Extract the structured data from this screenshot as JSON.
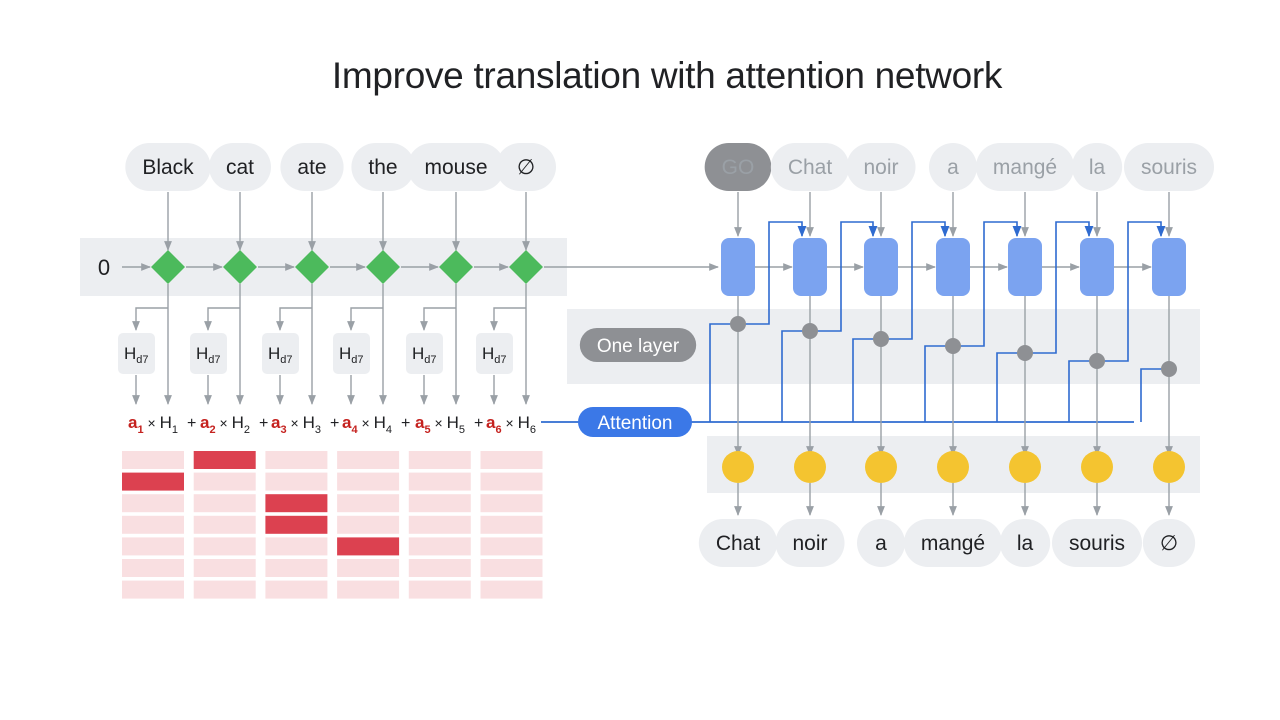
{
  "title": "Improve translation with attention network",
  "colors": {
    "encoder_node": "#4cba5c",
    "decoder_node": "#7ba3f0",
    "attention_line": "#2f6bd0",
    "attention_pill": "#3b78e7",
    "output_node": "#f4c430",
    "mix_node": "#8e9094",
    "arrow": "#9aa0a6",
    "band": "#eceef1",
    "token_bg": "#eceef1",
    "go_bg": "#8e9094",
    "weight_high": "#dc4150",
    "weight_low": "#f9dfe1",
    "coef_red": "#c5221f"
  },
  "encoder": {
    "initial_state": "0",
    "inputs": [
      "Black",
      "cat",
      "ate",
      "the",
      "mouse",
      "∅"
    ],
    "hidden_label": "H",
    "hidden_sub": "d7",
    "sum_terms": [
      {
        "coef": "a",
        "coef_sub": "1",
        "h": "H",
        "h_sub": "1"
      },
      {
        "coef": "a",
        "coef_sub": "2",
        "h": "H",
        "h_sub": "2"
      },
      {
        "coef": "a",
        "coef_sub": "3",
        "h": "H",
        "h_sub": "3"
      },
      {
        "coef": "a",
        "coef_sub": "4",
        "h": "H",
        "h_sub": "4"
      },
      {
        "coef": "a",
        "coef_sub": "5",
        "h": "H",
        "h_sub": "5"
      },
      {
        "coef": "a",
        "coef_sub": "6",
        "h": "H",
        "h_sub": "6"
      }
    ]
  },
  "decoder": {
    "inputs": [
      "GO",
      "Chat",
      "noir",
      "a",
      "mangé",
      "la",
      "souris"
    ],
    "outputs": [
      "Chat",
      "noir",
      "a",
      "mangé",
      "la",
      "souris",
      "∅"
    ],
    "layer_label": "One layer",
    "attention_label": "Attention"
  },
  "attention_weights": {
    "columns": 6,
    "rows": 7,
    "high_cells": [
      [
        0,
        1
      ],
      [
        1,
        0
      ],
      [
        2,
        2
      ],
      [
        3,
        2
      ],
      [
        4,
        3
      ]
    ]
  }
}
